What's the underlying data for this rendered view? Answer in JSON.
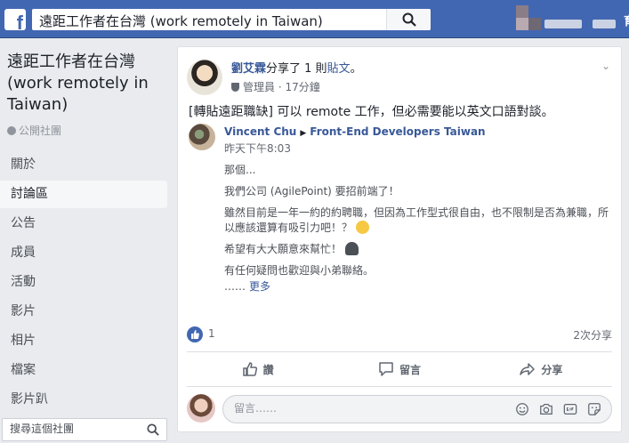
{
  "topbar": {
    "logo": "f",
    "search_value": "遠距工作者在台灣 (work remotely in Taiwan)",
    "search_icon": "search-icon",
    "right_text": "育"
  },
  "sidebar": {
    "group_title": "遠距工作者在台灣 (work remotely in Taiwan)",
    "privacy": "公開社團",
    "items": [
      {
        "label": "關於"
      },
      {
        "label": "討論區"
      },
      {
        "label": "公告"
      },
      {
        "label": "成員"
      },
      {
        "label": "活動"
      },
      {
        "label": "影片"
      },
      {
        "label": "相片"
      },
      {
        "label": "檔案"
      },
      {
        "label": "影片趴"
      }
    ],
    "search_placeholder": "搜尋這個社團"
  },
  "post": {
    "author": "劉艾霖",
    "action": "分享了 1 則",
    "object": "貼文",
    "punct": "。",
    "role": "管理員",
    "time": "17分鐘",
    "text": "[轉貼遠距職缺] 可以 remote 工作，但必需要能以英文口語對談。",
    "shared": {
      "author": "Vincent Chu",
      "group": "Front-End Developers Taiwan",
      "time": "昨天下午8:03",
      "lines": [
        "那個...",
        "我們公司 (AgilePoint) 要招前端了！",
        "雖然目前是一年一約的約聘職，但因為工作型式很自由，也不限制是否為兼職，所以應該還算有吸引力吧！？",
        "希望有大大願意來幫忙！",
        "有任何疑問也歡迎與小弟聯絡。"
      ],
      "ellipsis": "……",
      "more": "更多"
    },
    "like_count": "1",
    "share_count": "2次分享",
    "actions": {
      "like": "讚",
      "comment": "留言",
      "share": "分享"
    },
    "comment_placeholder": "留言……"
  }
}
